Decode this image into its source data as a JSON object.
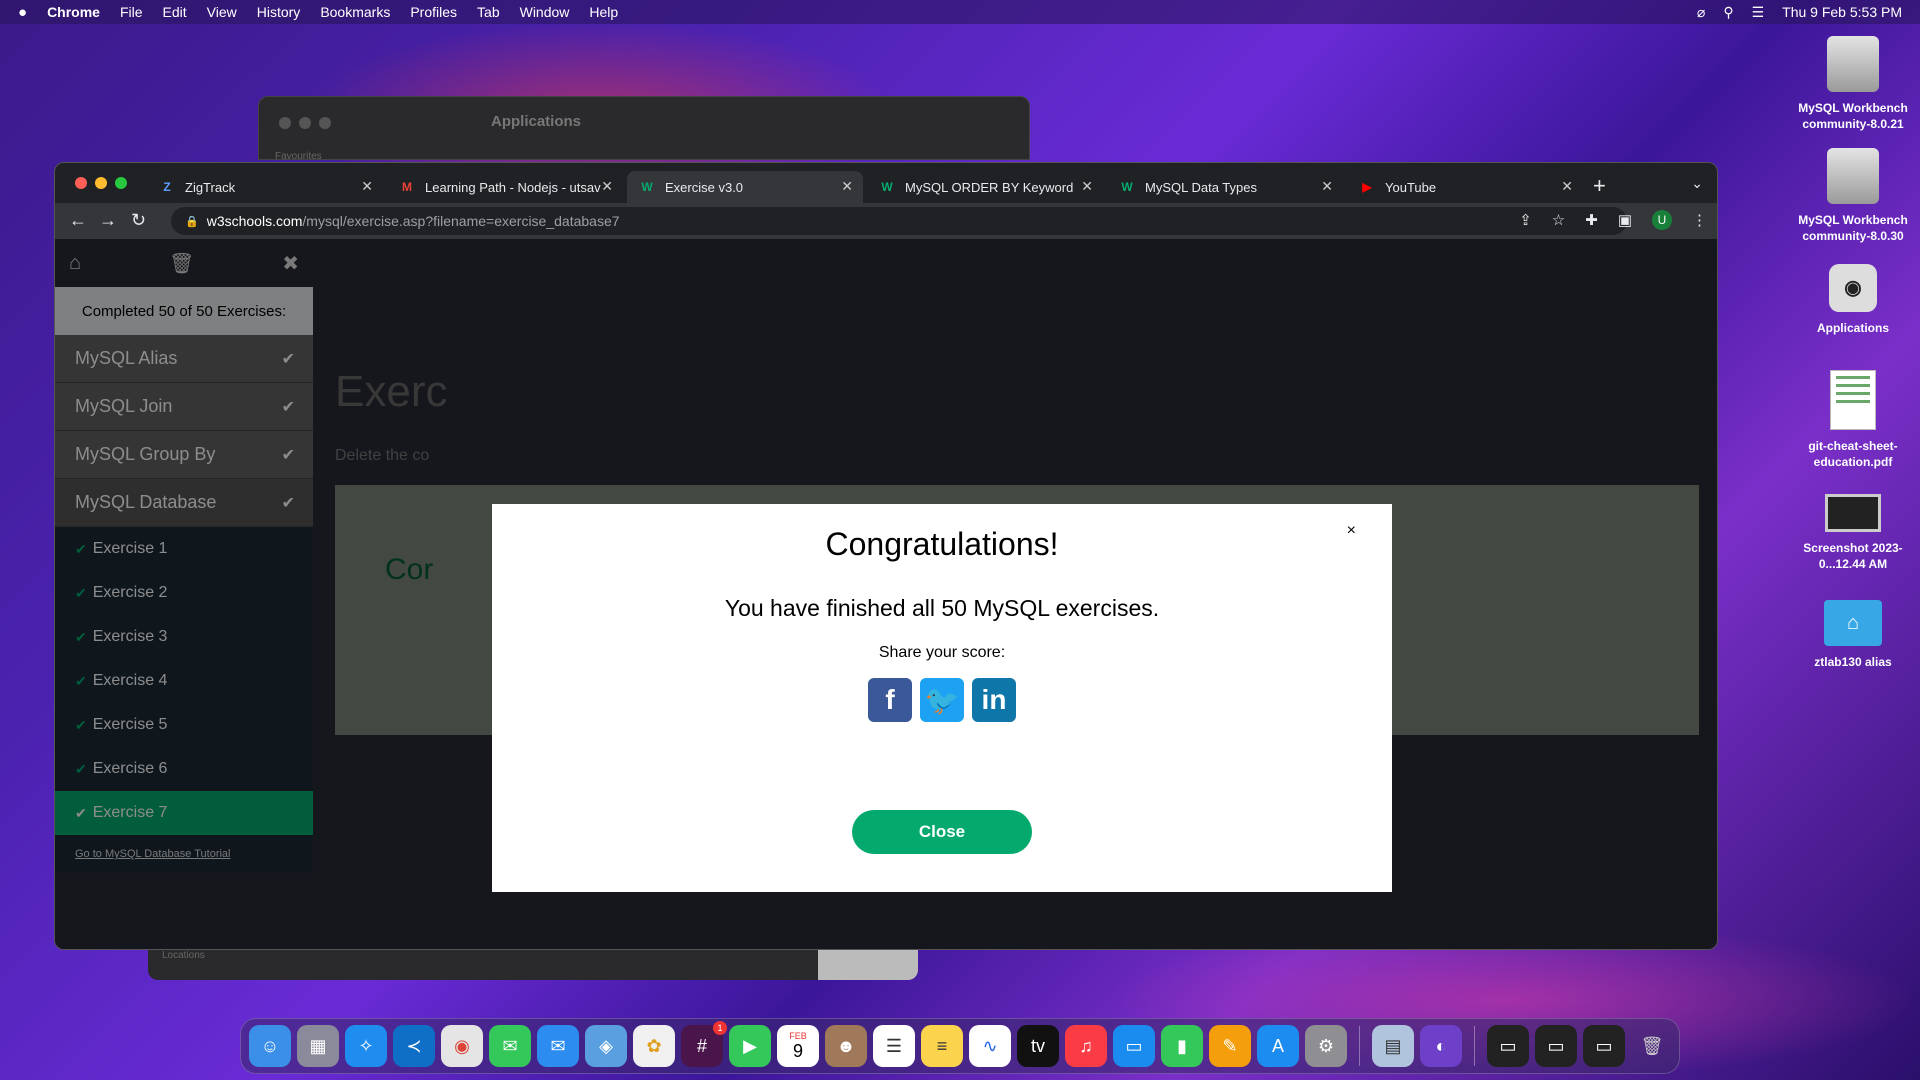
{
  "menubar": {
    "apple": "",
    "app": "Chrome",
    "items": [
      "File",
      "Edit",
      "View",
      "History",
      "Bookmarks",
      "Profiles",
      "Tab",
      "Window",
      "Help"
    ],
    "datetime": "Thu 9 Feb  5:53 PM"
  },
  "finder": {
    "title": "Applications",
    "favourites": "Favourites",
    "locations": "Locations"
  },
  "browser": {
    "tabs": [
      {
        "title": "ZigTrack",
        "favicon": "Z"
      },
      {
        "title": "Learning Path - Nodejs - utsav",
        "favicon": "M"
      },
      {
        "title": "Exercise v3.0",
        "favicon": "W"
      },
      {
        "title": "MySQL ORDER BY Keyword",
        "favicon": "W"
      },
      {
        "title": "MySQL Data Types",
        "favicon": "W"
      },
      {
        "title": "YouTube",
        "favicon": "▶"
      }
    ],
    "url_host": "w3schools.com",
    "url_path": "/mysql/exercise.asp?filename=exercise_database7",
    "profile_initial": "U"
  },
  "sidebar": {
    "completed": "Completed 50 of 50 Exercises:",
    "categories": [
      "MySQL Alias",
      "MySQL Join",
      "MySQL Group By",
      "MySQL Database"
    ],
    "exercises": [
      "Exercise 1",
      "Exercise 2",
      "Exercise 3",
      "Exercise 4",
      "Exercise 5",
      "Exercise 6",
      "Exercise 7"
    ],
    "tutorial_link": "Go to MySQL Database Tutorial"
  },
  "main": {
    "heading": "Exerc",
    "description": "Delete the co",
    "panel_text": "Cor"
  },
  "modal": {
    "title": "Congratulations!",
    "message": "You have finished all 50 MySQL exercises.",
    "share_label": "Share your score:",
    "close_label": "Close",
    "close_x": "×"
  },
  "desktop": {
    "icons": [
      {
        "label": "MySQL Workbench community-8.0.21",
        "icon": "disk-icon"
      },
      {
        "label": "MySQL Workbench community-8.0.30",
        "icon": "disk-icon"
      },
      {
        "label": "Applications",
        "icon": "camera-icon"
      },
      {
        "label": "git-cheat-sheet-education.pdf",
        "icon": "pdf-icon"
      },
      {
        "label": "Screenshot 2023-0...12.44 AM",
        "icon": "screenshot-icon"
      },
      {
        "label": "ztlab130 alias",
        "icon": "home-folder-icon"
      }
    ]
  },
  "dock": {
    "badge_slack": "1",
    "calendar_month": "FEB",
    "calendar_day": "9"
  }
}
